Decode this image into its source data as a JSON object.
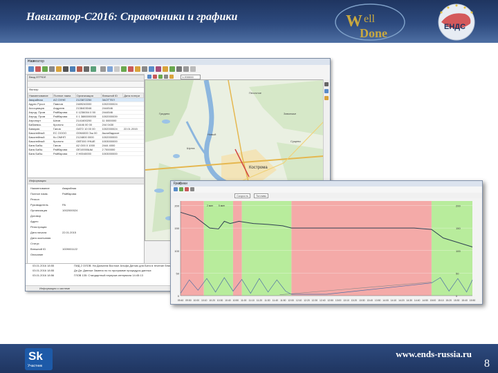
{
  "slide": {
    "title": "Навигатор-С2016: Справочники и графики",
    "footer_url": "www.ends-russia.ru",
    "page_number": "8",
    "logo_welldone": "WellDone",
    "logo_ends": "ЕНДС",
    "logo_sk": "Sk",
    "logo_sk_sub": "Участник",
    "colors": {
      "header": "#2d4a7e",
      "red_zone": "#f4aaa8",
      "green_zone": "#b8ec9c",
      "line": "#2e3f52"
    }
  },
  "main_window": {
    "title": "Навигатор",
    "left_panel": {
      "header": "Ввод ЕГРЮЛ",
      "filter": "Фильтр",
      "columns": [
        "Наименование",
        "Полное наим.",
        "Организация",
        "Внешний ID",
        "Дата потери"
      ],
      "rows": [
        [
          "Аварийная",
          "АО ОУНЕ",
          "2123872250",
          "ЗАОТТЕЛ",
          ""
        ],
        [
          "Адрес Руссл",
          "Павлов",
          "2489240000",
          "1002000024",
          ""
        ],
        [
          "Ассоциация",
          "Андреев",
          "2138403046",
          "2444546",
          ""
        ],
        [
          "Аэрод. Пром",
          "Райбарова",
          "0 1236004 0 50",
          "2444546",
          ""
        ],
        [
          "Аэрод. Пром",
          "Райбарова",
          "0 1 3880000000",
          "1002000039",
          ""
        ],
        [
          "Аэропорт",
          "Шеов",
          "2141600200",
          "11 0000000",
          ""
        ],
        [
          "Бабаевск.",
          "Кропотк",
          "С4446 00 00",
          "244 0430",
          ""
        ],
        [
          "Бавария",
          "Ганов",
          "ОАТО 10 00 00",
          "1002000024",
          "22.01.2015"
        ],
        [
          "Бакалейный",
          "ЕС ОООО",
          "О0М4000 Эш 00",
          "Ашхабадское",
          ""
        ],
        [
          "Бакалейный",
          "Ко ОМНП",
          "2124800 0000",
          "1002000000",
          ""
        ],
        [
          "Бакалейный",
          "Кропотк",
          "ОВТ000 УНШЕ",
          "1003000000",
          ""
        ],
        [
          "Банк Бабы",
          "Ганов",
          "А2 О00 0 1000",
          "2444 4000",
          ""
        ],
        [
          "Банк Бабы",
          "Райбарова",
          "ОЕ10000ШЫ",
          "2 7000000",
          ""
        ],
        [
          "Банк Бабы",
          "Райбарова",
          "2 Н0040000",
          "1003000000",
          ""
        ]
      ]
    },
    "properties_panel": {
      "header": "Информация",
      "rows": [
        [
          "Наименование",
          "Аварийная"
        ],
        [
          "Полное наим.",
          "Райбарова"
        ],
        [
          "Регион",
          ""
        ],
        [
          "Руководитель",
          "РА"
        ],
        [
          "Организация",
          "1002000024"
        ],
        [
          "Договор",
          ""
        ],
        [
          "Адрес",
          ""
        ],
        [
          "Регистрация",
          ""
        ],
        [
          "Дата начала",
          "22.01.2015"
        ],
        [
          "Дата окончания",
          ""
        ],
        [
          "Статус",
          ""
        ],
        [
          "Внешний ID",
          "1009001122"
        ],
        [
          "Описание",
          ""
        ]
      ]
    },
    "map": {
      "zoom_value": "1:200000",
      "place_labels": [
        "Новый",
        "Кострома",
        "Песочное",
        "Заволжье",
        "Шунга",
        "Сущево",
        "Апраксино",
        "Минское",
        "Гридино",
        "Кузьмищи",
        "Борщино"
      ]
    },
    "log": {
      "rows": [
        {
          "time": "03.01.2016 18:55",
          "text": "ПИД 2 ОЛОВ: На Дальнем Востоке Альфа Датчик для Бита в течение ближайшего времени"
        },
        {
          "time": "03.01.2016 18:55",
          "text": "Дп Дн: Данные Замена по по программе процедуры данных"
        },
        {
          "time": "03.01.2016 18:56",
          "text": "ГЛОВ 135: Стандартный перерыв интервала 14:45:13"
        }
      ],
      "footer": "Информация о системе"
    }
  },
  "charts_window": {
    "title": "Графики",
    "tab_left": "Скорость",
    "tab_right": "Топливо"
  },
  "chart_data": {
    "type": "line",
    "title": "",
    "xlabel": "",
    "ylabel": "",
    "x_ticks": [
      "09:40",
      "09:50",
      "10:00",
      "10:10",
      "10:20",
      "10:30",
      "10:40",
      "10:50",
      "11:00",
      "11:10",
      "11:20",
      "11:30",
      "11:40",
      "11:50",
      "12:00",
      "12:10",
      "12:20",
      "12:30",
      "12:40",
      "12:50",
      "13:00",
      "13:10",
      "13:20",
      "13:30",
      "13:40",
      "13:50",
      "14:00",
      "14:10",
      "14:20",
      "14:30",
      "14:40",
      "14:50",
      "15:00",
      "15:10",
      "15:20",
      "15:30",
      "15:40",
      "15:50"
    ],
    "y_ticks": [
      200,
      150,
      100,
      50,
      0
    ],
    "ylim": [
      0,
      210
    ],
    "zones": [
      {
        "color": "red",
        "from": 0.0,
        "to": 0.08
      },
      {
        "color": "green",
        "from": 0.08,
        "to": 0.18
      },
      {
        "color": "red",
        "from": 0.18,
        "to": 0.21
      },
      {
        "color": "green",
        "from": 0.21,
        "to": 0.38
      },
      {
        "color": "red",
        "from": 0.38,
        "to": 0.86
      },
      {
        "color": "green",
        "from": 0.86,
        "to": 1.0
      }
    ],
    "series": [
      {
        "values": [
          {
            "x": 0.0,
            "y": 185
          },
          {
            "x": 0.05,
            "y": 175
          },
          {
            "x": 0.1,
            "y": 150
          },
          {
            "x": 0.13,
            "y": 148
          },
          {
            "x": 0.15,
            "y": 165
          },
          {
            "x": 0.17,
            "y": 160
          },
          {
            "x": 0.2,
            "y": 165
          },
          {
            "x": 0.25,
            "y": 160
          },
          {
            "x": 0.3,
            "y": 158
          },
          {
            "x": 0.35,
            "y": 155
          },
          {
            "x": 0.38,
            "y": 150
          },
          {
            "x": 0.5,
            "y": 150
          },
          {
            "x": 0.6,
            "y": 150
          },
          {
            "x": 0.7,
            "y": 150
          },
          {
            "x": 0.8,
            "y": 150
          },
          {
            "x": 0.86,
            "y": 147
          },
          {
            "x": 0.9,
            "y": 128
          },
          {
            "x": 0.95,
            "y": 118
          },
          {
            "x": 1.0,
            "y": 108
          }
        ]
      },
      {
        "values": [
          {
            "x": 0.0,
            "y": 5
          },
          {
            "x": 0.03,
            "y": 35
          },
          {
            "x": 0.06,
            "y": 12
          },
          {
            "x": 0.09,
            "y": 38
          },
          {
            "x": 0.12,
            "y": 8
          },
          {
            "x": 0.15,
            "y": 40
          },
          {
            "x": 0.18,
            "y": 10
          },
          {
            "x": 0.21,
            "y": 36
          },
          {
            "x": 0.24,
            "y": 5
          },
          {
            "x": 0.27,
            "y": 38
          },
          {
            "x": 0.3,
            "y": 8
          },
          {
            "x": 0.33,
            "y": 35
          },
          {
            "x": 0.36,
            "y": 10
          },
          {
            "x": 0.38,
            "y": 3
          },
          {
            "x": 0.5,
            "y": 3
          },
          {
            "x": 0.86,
            "y": 28
          },
          {
            "x": 0.89,
            "y": 40
          },
          {
            "x": 0.92,
            "y": 10
          },
          {
            "x": 0.95,
            "y": 38
          },
          {
            "x": 0.98,
            "y": 8
          },
          {
            "x": 1.0,
            "y": 35
          }
        ]
      }
    ],
    "annotations": [
      "2 мин",
      "5 мин"
    ]
  }
}
